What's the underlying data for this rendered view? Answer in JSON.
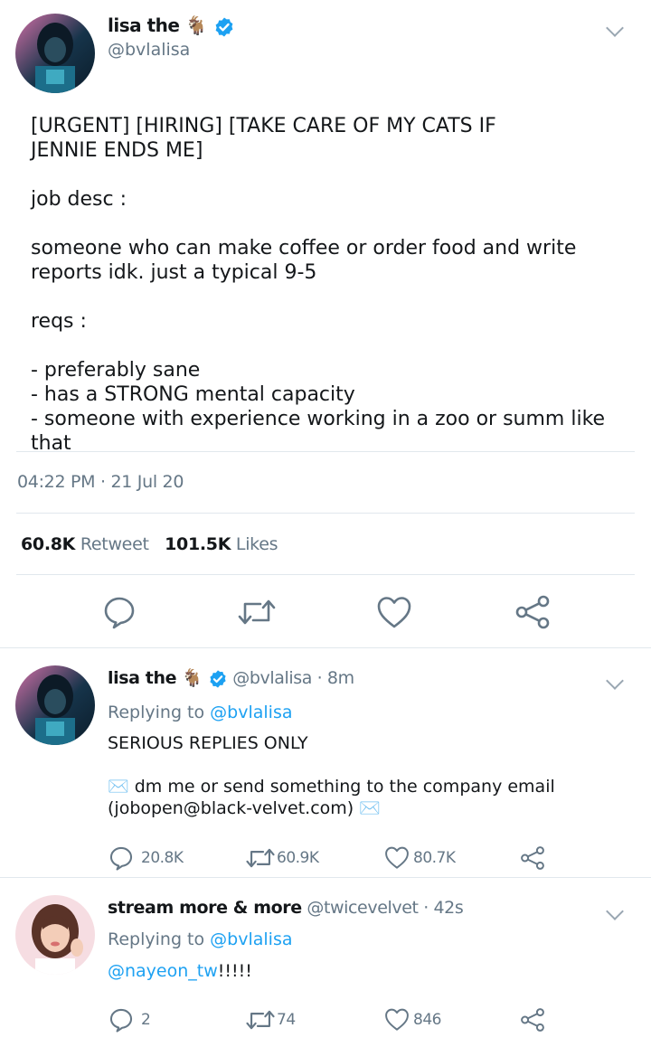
{
  "main_tweet": {
    "display_name": "lisa the",
    "emoji": "🐐",
    "handle": "@bvlalisa",
    "body": "[URGENT] [HIRING] [TAKE CARE OF MY CATS IF\nJENNIE ENDS ME]\n\njob desc :\n\nsomeone who can make coffee or order food and write\nreports idk. just a typical 9-5\n\nreqs :\n\n- preferably sane\n- has a STRONG mental capacity\n- someone with experience working in a zoo or summ like that",
    "timestamp": "04:22 PM · 21 Jul 20",
    "retweets_count": "60.8K",
    "retweets_label": "Retweet",
    "likes_count": "101.5K",
    "likes_label": "Likes"
  },
  "replies": [
    {
      "display_name": "lisa the",
      "emoji": "🐐",
      "handle": "@bvlalisa",
      "time": "· 8m",
      "replying_prefix": "Replying to",
      "replying_handle": "@bvlalisa",
      "line1": "SERIOUS REPLIES ONLY",
      "line2_emoji": "✉️",
      "line2_text": "dm me or send something to the company email",
      "line3_text": "(jobopen@black-velvet.com)",
      "line3_emoji": "✉️",
      "reply_count": "20.8K",
      "retweet_count": "60.9K",
      "like_count": "80.7K"
    },
    {
      "display_name": "stream more & more",
      "handle": "@twicevelvet",
      "time": "· 42s",
      "replying_prefix": "Replying to",
      "replying_handle": "@bvlalisa",
      "mention": "@nayeon_tw",
      "mention_suffix": "!!!!!",
      "reply_count": "2",
      "retweet_count": "74",
      "like_count": "846"
    }
  ],
  "colors": {
    "text": "#14171a",
    "secondary": "#657786",
    "link": "#1da1f2",
    "divider": "#e1e8ed",
    "verified": "#1da1f2"
  },
  "icons": [
    "chevron-down-icon",
    "verified-badge-icon",
    "reply-icon",
    "retweet-icon",
    "like-icon",
    "share-icon"
  ]
}
